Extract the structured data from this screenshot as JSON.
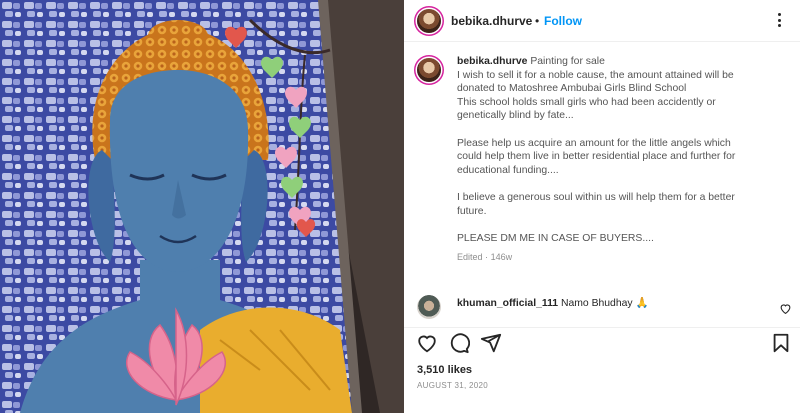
{
  "post": {
    "username": "bebika.dhurve",
    "separator": "•",
    "follow_label": "Follow",
    "more_icon": "more-horizontal-icon"
  },
  "caption": {
    "username": "bebika.dhurve",
    "lines": [
      "Painting for sale",
      "I wish to sell it for a noble cause, the amount attained will be",
      "donated to Matoshree Ambubai Girls Blind School",
      "This school holds small girls who had been accidently or",
      "genetically blind by fate...",
      "",
      "Please help us acquire an amount for the little angels which",
      "could help them live in better residential place and further for",
      "educational funding....",
      "",
      "I believe a generous soul within us will help them for a better",
      "future.",
      "",
      "PLEASE DM ME IN CASE OF BUYERS...."
    ],
    "edited": "Edited",
    "meta_separator": "·",
    "age": "146w"
  },
  "comment": {
    "username": "khuman_official_111",
    "text": "Namo Bhudhay 🙏"
  },
  "actions": {
    "like_icon": "heart-icon",
    "comment_icon": "comment-icon",
    "share_icon": "share-icon",
    "save_icon": "bookmark-icon"
  },
  "likes": "3,510 likes",
  "date": "AUGUST 31, 2020",
  "colors": {
    "accent": "#0095f6",
    "text": "#262626",
    "muted": "#8e8e8e",
    "story_ring": "#d6249f",
    "painting_background": "#3c4fa8",
    "buddha_skin": "#4f7fae",
    "hair": "#d98a2b",
    "robe": "#e9ad2e",
    "lotus": "#f08aa8"
  }
}
